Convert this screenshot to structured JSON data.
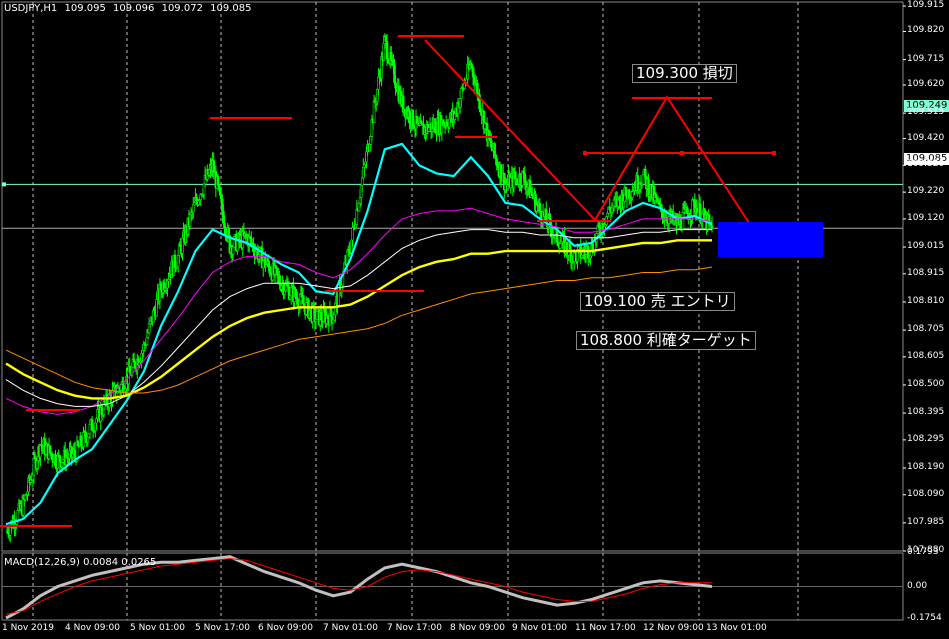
{
  "chart_data": {
    "type": "line",
    "header": {
      "symbol": "USDJPY,H1",
      "ohlc": [
        "109.095",
        "109.096",
        "109.072",
        "109.085"
      ]
    },
    "y_ticks": [
      "109.915",
      "109.820",
      "109.715",
      "109.620",
      "109.515",
      "109.420",
      "109.320",
      "109.220",
      "109.120",
      "109.015",
      "108.915",
      "108.810",
      "108.705",
      "108.605",
      "108.500",
      "108.395",
      "108.295",
      "108.190",
      "108.090",
      "107.985",
      "107.880"
    ],
    "ylim": [
      107.88,
      109.93
    ],
    "x_ticks": [
      "1 Nov 2019",
      "4 Nov 09:00",
      "5 Nov 01:00",
      "5 Nov 17:00",
      "6 Nov 09:00",
      "7 Nov 01:00",
      "7 Nov 17:00",
      "8 Nov 09:00",
      "9 Nov 01:00",
      "11 Nov 17:00",
      "12 Nov 09:00",
      "13 Nov 01:00"
    ],
    "price_tags": {
      "level_line": "109.249",
      "current": "109.085"
    },
    "annotations": {
      "stop_loss": "109.300 損切",
      "entry": "109.100 売 エントリ",
      "take_profit": "108.800 利確ターゲット"
    },
    "close_path": [
      107.95,
      108.05,
      108.28,
      108.22,
      108.24,
      108.35,
      108.45,
      108.52,
      108.64,
      108.86,
      108.98,
      109.18,
      109.32,
      109.02,
      109.05,
      108.96,
      108.88,
      108.82,
      108.75,
      108.76,
      109.02,
      109.38,
      109.78,
      109.55,
      109.45,
      109.47,
      109.5,
      109.7,
      109.42,
      109.25,
      109.28,
      109.15,
      109.05,
      108.98,
      109.01,
      109.15,
      109.21,
      109.28,
      109.15,
      109.1,
      109.17,
      109.08
    ],
    "series": [
      {
        "values": [
          107.98,
          108.0,
          108.06,
          108.17,
          108.22,
          108.26,
          108.35,
          108.44,
          108.55,
          108.72,
          108.85,
          109.0,
          109.08,
          109.05,
          109.03,
          108.99,
          108.95,
          108.92,
          108.85,
          108.84,
          108.97,
          109.15,
          109.38,
          109.4,
          109.32,
          109.29,
          109.28,
          109.35,
          109.28,
          109.18,
          109.17,
          109.12,
          109.08,
          109.02,
          109.03,
          109.09,
          109.15,
          109.18,
          109.16,
          109.12,
          109.13,
          109.1
        ]
      },
      {
        "values": [
          108.45,
          108.42,
          108.4,
          108.39,
          108.4,
          108.42,
          108.46,
          108.52,
          108.59,
          108.67,
          108.75,
          108.84,
          108.92,
          108.96,
          108.98,
          108.98,
          108.96,
          108.95,
          108.92,
          108.9,
          108.93,
          108.99,
          109.06,
          109.12,
          109.14,
          109.15,
          109.15,
          109.16,
          109.14,
          109.12,
          109.11,
          109.1,
          109.09,
          109.07,
          109.07,
          109.08,
          109.1,
          109.12,
          109.12,
          109.12,
          109.12,
          109.11
        ]
      },
      {
        "values": [
          108.52,
          108.48,
          108.45,
          108.43,
          108.42,
          108.42,
          108.43,
          108.46,
          108.51,
          108.57,
          108.64,
          108.71,
          108.78,
          108.83,
          108.86,
          108.88,
          108.88,
          108.88,
          108.87,
          108.86,
          108.87,
          108.91,
          108.96,
          109.01,
          109.04,
          109.06,
          109.07,
          109.08,
          109.08,
          109.07,
          109.07,
          109.06,
          109.06,
          109.05,
          109.05,
          109.05,
          109.06,
          109.07,
          109.07,
          109.08,
          109.08,
          109.08
        ]
      },
      {
        "values": [
          108.58,
          108.54,
          108.51,
          108.48,
          108.46,
          108.45,
          108.45,
          108.46,
          108.49,
          108.53,
          108.58,
          108.63,
          108.68,
          108.72,
          108.75,
          108.77,
          108.78,
          108.79,
          108.79,
          108.79,
          108.8,
          108.83,
          108.87,
          108.91,
          108.94,
          108.96,
          108.97,
          108.99,
          108.99,
          109.0,
          109.0,
          109.0,
          109.0,
          109.0,
          109.0,
          109.01,
          109.02,
          109.03,
          109.03,
          109.04,
          109.04,
          109.04
        ]
      },
      {
        "values": [
          108.63,
          108.6,
          108.57,
          108.54,
          108.51,
          108.49,
          108.48,
          108.47,
          108.47,
          108.48,
          108.5,
          108.53,
          108.56,
          108.59,
          108.61,
          108.63,
          108.65,
          108.67,
          108.68,
          108.69,
          108.7,
          108.71,
          108.73,
          108.76,
          108.78,
          108.8,
          108.82,
          108.84,
          108.85,
          108.86,
          108.87,
          108.88,
          108.89,
          108.89,
          108.9,
          108.9,
          108.91,
          108.92,
          108.92,
          108.93,
          108.93,
          108.94
        ]
      }
    ],
    "series_colors": [
      "#00ffff",
      "#ff00ff",
      "#ffffff",
      "#ffff00",
      "#ff8c00"
    ],
    "macd": {
      "label": "MACD(12,26,9) 0.0084 0.0265",
      "y_ticks": [
        "0.1793",
        "0.00",
        "-0.1754"
      ],
      "ylim": [
        -0.18,
        0.18
      ],
      "main": [
        -0.17,
        -0.12,
        -0.05,
        0.0,
        0.03,
        0.06,
        0.08,
        0.1,
        0.12,
        0.13,
        0.13,
        0.14,
        0.15,
        0.16,
        0.12,
        0.08,
        0.05,
        0.02,
        -0.02,
        -0.05,
        -0.03,
        0.04,
        0.1,
        0.12,
        0.1,
        0.08,
        0.05,
        0.02,
        0.0,
        -0.03,
        -0.06,
        -0.08,
        -0.1,
        -0.09,
        -0.07,
        -0.04,
        -0.01,
        0.02,
        0.03,
        0.02,
        0.01,
        0.0
      ],
      "signal": [
        -0.15,
        -0.13,
        -0.08,
        -0.04,
        0.0,
        0.03,
        0.05,
        0.07,
        0.09,
        0.11,
        0.12,
        0.13,
        0.14,
        0.15,
        0.14,
        0.11,
        0.08,
        0.05,
        0.02,
        -0.01,
        -0.02,
        0.0,
        0.05,
        0.08,
        0.09,
        0.08,
        0.06,
        0.04,
        0.02,
        0.0,
        -0.03,
        -0.05,
        -0.07,
        -0.08,
        -0.08,
        -0.06,
        -0.04,
        -0.01,
        0.01,
        0.02,
        0.02,
        0.02
      ]
    },
    "colors": {
      "background": "#000000",
      "candle": "#00ff00",
      "marker": "#ff0000",
      "target_box": "#0000ff",
      "level_line": "#7fffd4"
    }
  }
}
